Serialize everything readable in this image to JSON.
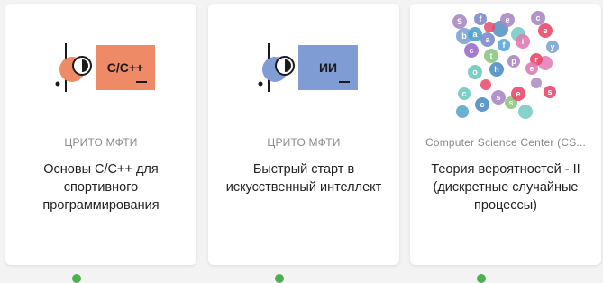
{
  "colors": {
    "cpp_accent": "#ee8a66",
    "ai_accent": "#7f9cd4",
    "status_green": "#4caf50"
  },
  "cards": [
    {
      "logo_text": "C/C++",
      "org": "ЦРИТО МФТИ",
      "title": "Основы С/С++ для спортивного программирования"
    },
    {
      "logo_text": "ИИ",
      "org": "ЦРИТО МФТИ",
      "title": "Быстрый старт в искусственный интеллект"
    },
    {
      "org": "Computer Science Center (CS...",
      "title": "Теория вероятностей - II (дискретные случайные процессы)",
      "bubble_letters": [
        "S",
        "f",
        "e",
        "с",
        "b",
        "a",
        "а",
        "f",
        "i",
        "e",
        "y",
        "c",
        "t",
        "р",
        "r",
        "о",
        "h",
        "e",
        "c",
        "c",
        "s",
        "s",
        "e",
        "s"
      ]
    }
  ]
}
